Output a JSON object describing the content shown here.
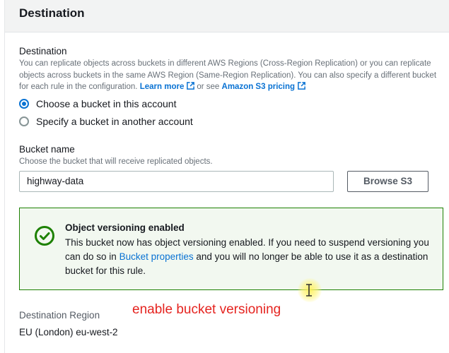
{
  "header": {
    "title": "Destination"
  },
  "destination": {
    "label": "Destination",
    "description_pre": "You can replicate objects across buckets in different AWS Regions (Cross-Region Replication) or you can replicate objects across buckets in the same AWS Region (Same-Region Replication). You can also specify a different bucket for each rule in the configuration.",
    "learn_more": "Learn more",
    "or_see": "or see",
    "pricing_link": "Amazon S3 pricing",
    "options": [
      {
        "label": "Choose a bucket in this account",
        "selected": true
      },
      {
        "label": "Specify a bucket in another account",
        "selected": false
      }
    ]
  },
  "bucket": {
    "label": "Bucket name",
    "description": "Choose the bucket that will receive replicated objects.",
    "value": "highway-data",
    "browse_button": "Browse S3"
  },
  "alert": {
    "title": "Object versioning enabled",
    "body_pre": "This bucket now has object versioning enabled. If you need to suspend versioning you can do so in",
    "link": "Bucket properties",
    "body_post": "and you will no longer be able to use it as a destination bucket for this rule.",
    "icon": "check-circle-icon",
    "color": "#1d8102"
  },
  "region": {
    "label": "Destination Region",
    "value": "EU (London) eu-west-2"
  },
  "annotation": {
    "text": "enable bucket versioning",
    "color": "#e52420"
  },
  "colors": {
    "link": "#0972d3",
    "header_bg": "#f2f3f3",
    "success_bg": "#f2f8f0"
  }
}
